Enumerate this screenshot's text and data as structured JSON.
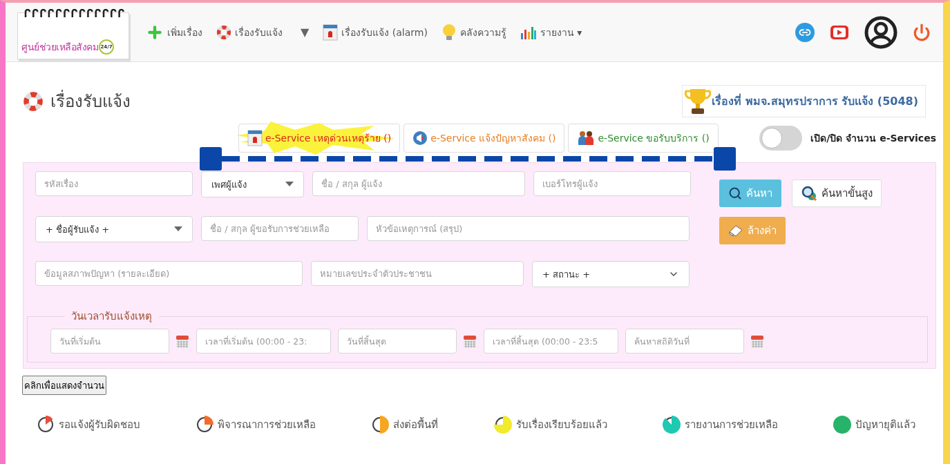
{
  "navbar": {
    "logo": {
      "text": "ศูนย์ช่วยเหลือสังคม",
      "badge": "24/7"
    },
    "menu": [
      {
        "label": "เพิ่มเรื่อง",
        "kind": "add"
      },
      {
        "label": "เรื่องรับแจ้ง",
        "kind": "lifebuoy",
        "split_caret": "▼"
      },
      {
        "label": "เรื่องรับแจ้ง (alarm)",
        "kind": "alarm"
      },
      {
        "label": "คลังความรู้",
        "kind": "bulb"
      },
      {
        "label": "รายงาน",
        "kind": "chart",
        "caret": "▾"
      }
    ]
  },
  "page_title": "เรื่องรับแจ้ง",
  "trophy": "เรื่องที่ พมจ.สมุทรปราการ รับแจ้ง (5048)",
  "tabs": [
    {
      "label": "e-Service เหตุด่วนเหตุร้าย ()",
      "kind": "alarm",
      "color": "#d9261c",
      "selected": true
    },
    {
      "label": "e-Service แจ้งปัญหาสังคม ()",
      "kind": "megaphone",
      "color": "#e67e22",
      "selected": false
    },
    {
      "label": "e-Service ขอรับบริการ ()",
      "kind": "people",
      "color": "#2e8b2e",
      "selected": false
    }
  ],
  "toggle": {
    "label": "เปิด/ปิด จำนวน e-Services",
    "on": false
  },
  "form": {
    "rows": [
      {
        "fields": [
          {
            "kind": "input",
            "placeholder": "รหัสเรื่อง"
          },
          {
            "kind": "select",
            "value": "เพศผู้แจ้ง"
          },
          {
            "kind": "input",
            "placeholder": "ชื่อ / สกุล ผู้แจ้ง"
          },
          {
            "kind": "input",
            "placeholder": "เบอร์โทรผู้แจ้ง"
          }
        ]
      },
      {
        "fields": [
          {
            "kind": "select",
            "value": "+ ชื่อผู้รับแจ้ง +"
          },
          {
            "kind": "input",
            "placeholder": "ชื่อ / สกุล ผู้ขอรับการช่วยเหลือ"
          },
          {
            "kind": "input",
            "placeholder": "หัวข้อเหตุการณ์ (สรุป)"
          }
        ]
      },
      {
        "fields": [
          {
            "kind": "input",
            "placeholder": "ข้อมูลสภาพปัญหา (รายละเอียด)"
          },
          {
            "kind": "input",
            "placeholder": "หมายเลขประจำตัวประชาชน"
          },
          {
            "kind": "chevron-select",
            "value": "+ สถานะ +"
          }
        ]
      }
    ],
    "buttons": [
      {
        "label": "ค้นหา",
        "kind": "search"
      },
      {
        "label": "ค้นหาขั้นสูง",
        "kind": "advanced"
      },
      {
        "label": "ล้างค่า",
        "kind": "clear"
      }
    ],
    "date_section": {
      "legend": "วันเวลารับแจ้งเหตุ",
      "fields": [
        {
          "kind": "date",
          "placeholder": "วันที่เริ่มต้น"
        },
        {
          "kind": "time",
          "placeholder": "เวลาที่เริ่มต้น (00:00 - 23:"
        },
        {
          "kind": "date",
          "placeholder": "วันที่สิ้นสุด"
        },
        {
          "kind": "time",
          "placeholder": "เวลาที่สิ้นสุด (00:00 - 23:5"
        },
        {
          "kind": "date",
          "placeholder": "ค้นหาสถิติวันที่"
        }
      ]
    }
  },
  "count_button": "คลิกเพื่อแสดงจำนวน",
  "status_legend": [
    {
      "label": "รอแจ้งผู้รับผิดชอบ",
      "color": "#e74c3c",
      "kind": "eighth"
    },
    {
      "label": "พิจารณาการช่วยเหลือ",
      "color": "#f26b2a",
      "kind": "quarter"
    },
    {
      "label": "ส่งต่อพื้นที่",
      "color": "#f5a623",
      "kind": "half"
    },
    {
      "label": "รับเรื่องเรียบร้อยแล้ว",
      "color": "#f2ea2c",
      "kind": "three-quarter"
    },
    {
      "label": "รายงานการช่วยเหลือ",
      "color": "#1fc8b0",
      "kind": "seven-eighths"
    },
    {
      "label": "ปัญหายุติแล้ว",
      "color": "#27b36a",
      "kind": "full"
    }
  ]
}
